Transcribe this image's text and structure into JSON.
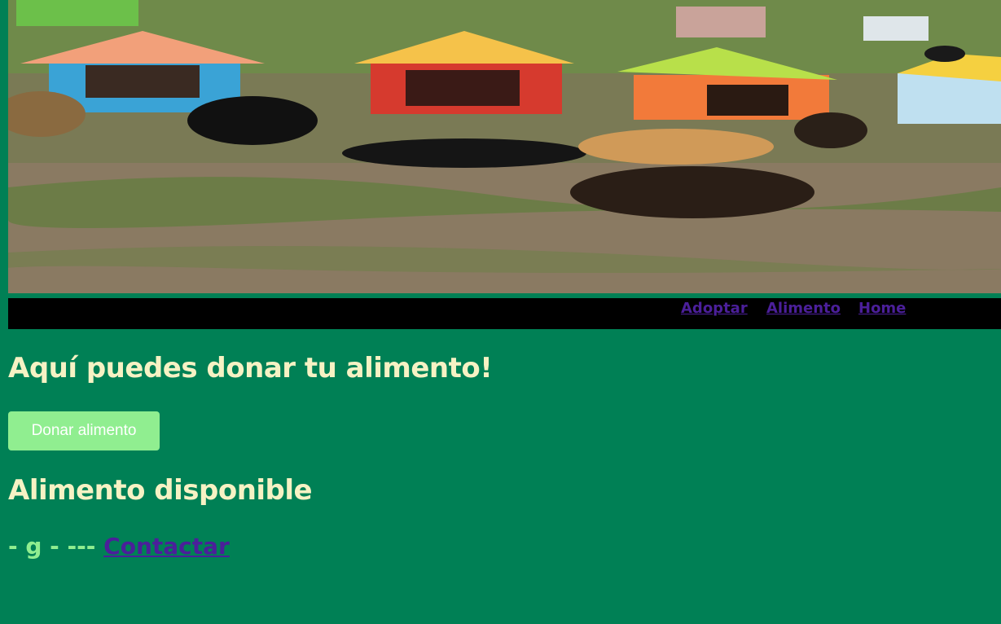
{
  "hero": {
    "image_description_icon": "dog-shelter-photo"
  },
  "nav": {
    "items": [
      {
        "label": "Adoptar"
      },
      {
        "label": "Alimento"
      },
      {
        "label": "Home"
      }
    ]
  },
  "main": {
    "heading": "Aquí puedes donar tu alimento!",
    "donate_button": "Donar alimento",
    "available_heading": "Alimento disponible",
    "food_item_text": "- g - ---",
    "contact_link": "Contactar"
  },
  "colors": {
    "background": "#008055",
    "heading": "#f6f2c4",
    "button": "#90ee90",
    "link": "#4b1f9a",
    "navbar": "#000000"
  }
}
